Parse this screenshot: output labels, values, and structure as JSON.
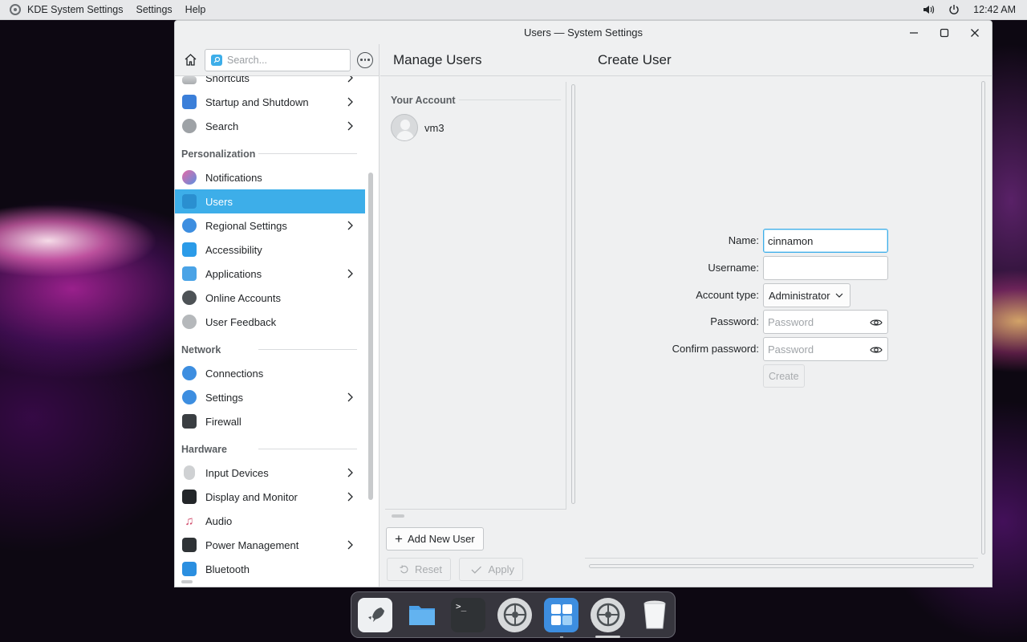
{
  "top_panel": {
    "app_name": "KDE System Settings",
    "menu": [
      "Settings",
      "Help"
    ],
    "clock": "12:42 AM"
  },
  "window": {
    "title": "Users — System Settings"
  },
  "sidebar": {
    "search_placeholder": "Search...",
    "items": [
      {
        "label": "Shortcuts",
        "icon": "keyboard-icon",
        "chevron": true
      },
      {
        "label": "Startup and Shutdown",
        "icon": "startup-icon",
        "chevron": true
      },
      {
        "label": "Search",
        "icon": "search-settings-icon",
        "chevron": true
      }
    ],
    "sections": [
      {
        "title": "Personalization",
        "items": [
          {
            "label": "Notifications",
            "icon": "notifications-icon",
            "chevron": false
          },
          {
            "label": "Users",
            "icon": "users-icon",
            "chevron": false,
            "selected": true
          },
          {
            "label": "Regional Settings",
            "icon": "globe-icon",
            "chevron": true
          },
          {
            "label": "Accessibility",
            "icon": "accessibility-icon",
            "chevron": false
          },
          {
            "label": "Applications",
            "icon": "applications-icon",
            "chevron": true
          },
          {
            "label": "Online Accounts",
            "icon": "online-accounts-icon",
            "chevron": false
          },
          {
            "label": "User Feedback",
            "icon": "feedback-icon",
            "chevron": false
          }
        ]
      },
      {
        "title": "Network",
        "items": [
          {
            "label": "Connections",
            "icon": "connections-icon",
            "chevron": false
          },
          {
            "label": "Settings",
            "icon": "network-settings-icon",
            "chevron": true
          },
          {
            "label": "Firewall",
            "icon": "firewall-icon",
            "chevron": false
          }
        ]
      },
      {
        "title": "Hardware",
        "items": [
          {
            "label": "Input Devices",
            "icon": "mouse-icon",
            "chevron": true
          },
          {
            "label": "Display and Monitor",
            "icon": "display-icon",
            "chevron": true
          },
          {
            "label": "Audio",
            "icon": "audio-icon",
            "chevron": false
          },
          {
            "label": "Power Management",
            "icon": "battery-icon",
            "chevron": true
          },
          {
            "label": "Bluetooth",
            "icon": "bluetooth-icon",
            "chevron": false
          }
        ]
      }
    ]
  },
  "manage_users": {
    "title": "Manage Users",
    "your_account_label": "Your Account",
    "account_name": "vm3",
    "add_user_label": "Add New User",
    "reset_label": "Reset",
    "apply_label": "Apply"
  },
  "create_user": {
    "title": "Create User",
    "name_label": "Name:",
    "name_value": "cinnamon",
    "username_label": "Username:",
    "username_value": "",
    "account_type_label": "Account type:",
    "account_type_value": "Administrator",
    "password_label": "Password:",
    "password_placeholder": "Password",
    "confirm_label": "Confirm password:",
    "confirm_placeholder": "Password",
    "create_label": "Create"
  },
  "dock": {
    "items": [
      "launcher-icon",
      "files-icon",
      "terminal-icon",
      "settings-icon",
      "calculator-icon",
      "system-settings-icon",
      "trash-icon"
    ]
  },
  "colors": {
    "accent": "#3daee9",
    "window_bg": "#eff0f1"
  }
}
